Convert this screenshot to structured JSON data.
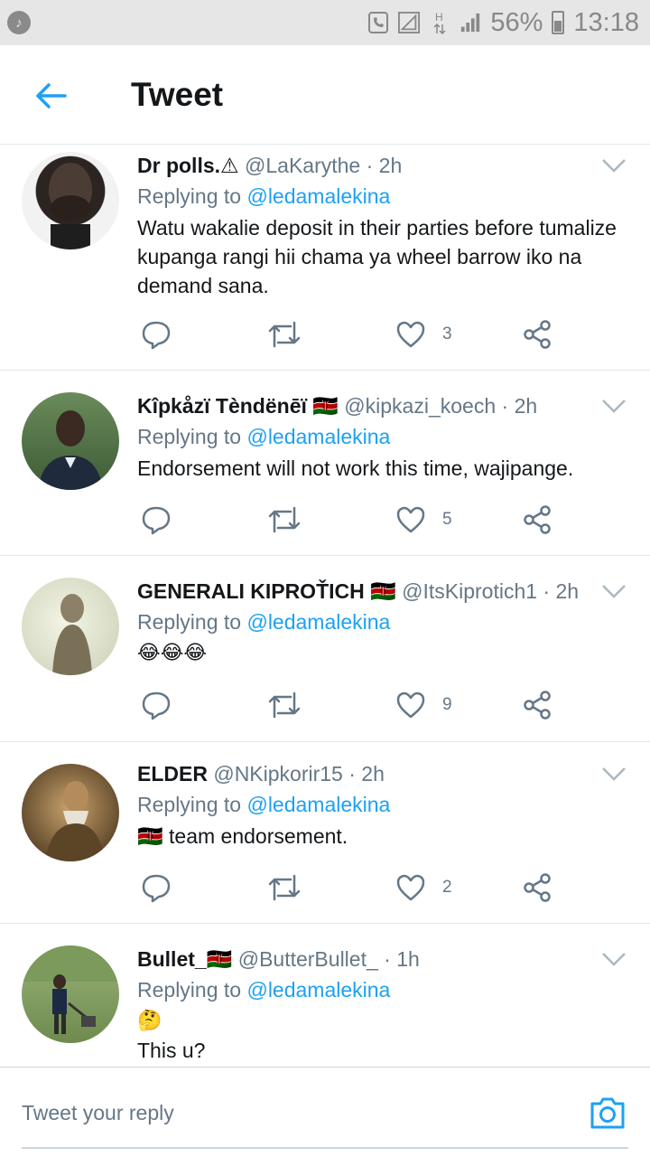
{
  "status_bar": {
    "battery": "56%",
    "time": "13:18"
  },
  "header": {
    "title": "Tweet"
  },
  "tweets": [
    {
      "name": "Dr polls.⚠",
      "handle": "@LaKarythe",
      "time": "· 2h",
      "replying_prefix": "Replying to",
      "replying_to": "@ledamalekina",
      "text": "Watu wakalie deposit in their parties before tumalize kupanga rangi hii chama ya wheel barrow iko na demand sana.",
      "likes": "3"
    },
    {
      "name": "Kîpkåzï Tèndënēï 🇰🇪",
      "handle": "@kipkazi_koech",
      "time": "· 2h",
      "replying_prefix": "Replying to",
      "replying_to": "@ledamalekina",
      "text": "Endorsement will not work this time, wajipange.",
      "likes": "5"
    },
    {
      "name": "GENERALI KIPROŤICH 🇰🇪",
      "handle": "@ItsKiprotich1",
      "time": "· 2h",
      "replying_prefix": "Replying to",
      "replying_to": "@ledamalekina",
      "text": "😂😂😂",
      "likes": "9"
    },
    {
      "name": "ELDER",
      "handle": "@NKipkorir15",
      "time": "· 2h",
      "replying_prefix": "Replying to",
      "replying_to": "@ledamalekina",
      "text": "🇰🇪 team endorsement.",
      "likes": "2"
    },
    {
      "name": "Bullet_🇰🇪",
      "handle": "@ButterBullet_",
      "time": "· 1h",
      "replying_prefix": "Replying to",
      "replying_to": "@ledamalekina",
      "text": "🤔",
      "text2": "This u?"
    }
  ],
  "reply_bar": {
    "placeholder": "Tweet your reply"
  },
  "colors": {
    "accent": "#1da1f2",
    "muted": "#657786",
    "divider": "#e1e8ed"
  }
}
